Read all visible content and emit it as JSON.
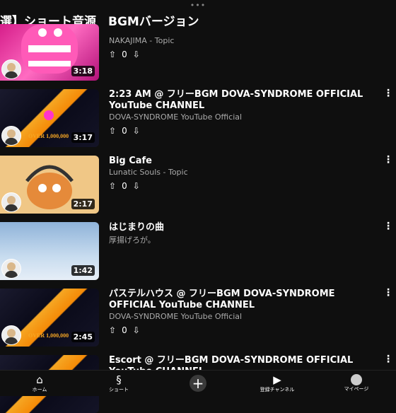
{
  "header": {
    "title": "選】ショート音源　BGMバージョン"
  },
  "videos": [
    {
      "title": "",
      "channel": "NAKAJIMA - Topic",
      "likes": "0",
      "duration": "3:18"
    },
    {
      "title": "2:23 AM @ フリーBGM DOVA-SYNDROME OFFICIAL YouTube CHANNEL",
      "channel": "DOVA-SYNDROME YouTube Official",
      "likes": "0",
      "duration": "3:17",
      "thumb_text": "OVER 1,000,000"
    },
    {
      "title": "Big Cafe",
      "channel": "Lunatic Souls - Topic",
      "likes": "0",
      "duration": "2:17"
    },
    {
      "title": "はじまりの曲",
      "channel": "厚揚げろが。",
      "likes": "0",
      "duration": "1:42"
    },
    {
      "title": "パステルハウス @ フリーBGM DOVA-SYNDROME OFFICIAL YouTube CHANNEL",
      "channel": "DOVA-SYNDROME YouTube Official",
      "likes": "0",
      "duration": "2:45",
      "thumb_text": "OVER 1,000,000"
    },
    {
      "title": "Escort @ フリーBGM DOVA-SYNDROME OFFICIAL YouTube CHANNEL",
      "channel": "",
      "likes": "",
      "duration": ""
    }
  ],
  "nav": [
    {
      "label": "ホーム",
      "icon": "home-icon"
    },
    {
      "label": "ショート",
      "icon": "shorts-icon"
    },
    {
      "label": "",
      "icon": "create-icon"
    },
    {
      "label": "登録チャンネル",
      "icon": "subscriptions-icon"
    },
    {
      "label": "マイページ",
      "icon": "avatar-icon"
    }
  ]
}
